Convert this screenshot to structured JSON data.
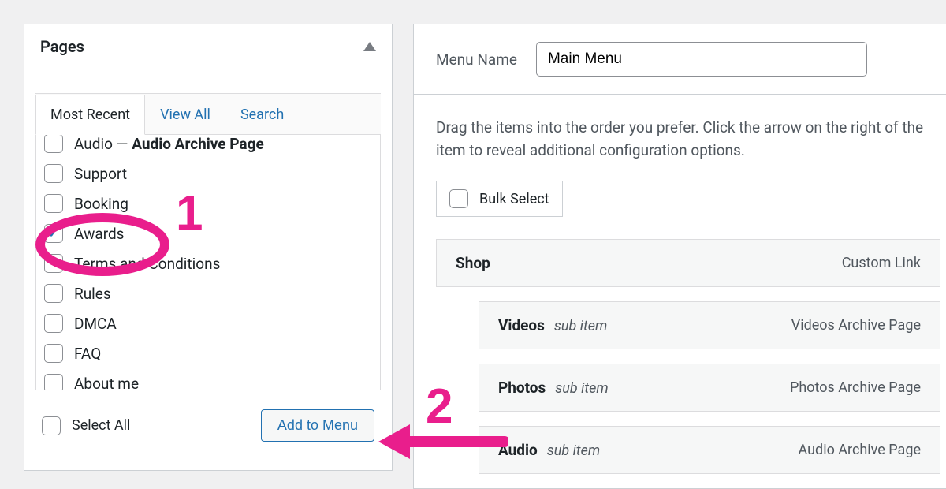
{
  "pages_panel": {
    "title": "Pages",
    "tabs": [
      "Most Recent",
      "View All",
      "Search"
    ],
    "active_tab": 0,
    "items": [
      {
        "label_prefix": "Audio — ",
        "label_bold": "Audio Archive Page",
        "checked": false
      },
      {
        "label": "Support",
        "checked": false
      },
      {
        "label": "Booking",
        "checked": false
      },
      {
        "label": "Awards",
        "checked": true
      },
      {
        "label": "Terms and Conditions",
        "checked": false
      },
      {
        "label": "Rules",
        "checked": false
      },
      {
        "label": "DMCA",
        "checked": false
      },
      {
        "label": "FAQ",
        "checked": false
      },
      {
        "label": "About me",
        "checked": false
      }
    ],
    "select_all": "Select All",
    "add_btn": "Add to Menu"
  },
  "menu_panel": {
    "menu_name_label": "Menu Name",
    "menu_name_value": "Main Menu",
    "drag_hint": "Drag the items into the order you prefer. Click the arrow on the right of the item to reveal additional configuration options.",
    "bulk_select": "Bulk Select",
    "items": [
      {
        "title": "Shop",
        "sub": false,
        "type": "Custom Link"
      },
      {
        "title": "Videos",
        "sub": true,
        "sub_label": "sub item",
        "type": "Videos Archive Page"
      },
      {
        "title": "Photos",
        "sub": true,
        "sub_label": "sub item",
        "type": "Photos Archive Page"
      },
      {
        "title": "Audio",
        "sub": true,
        "sub_label": "sub item",
        "type": "Audio Archive Page"
      }
    ]
  },
  "annotations": {
    "num1": "1",
    "num2": "2"
  }
}
